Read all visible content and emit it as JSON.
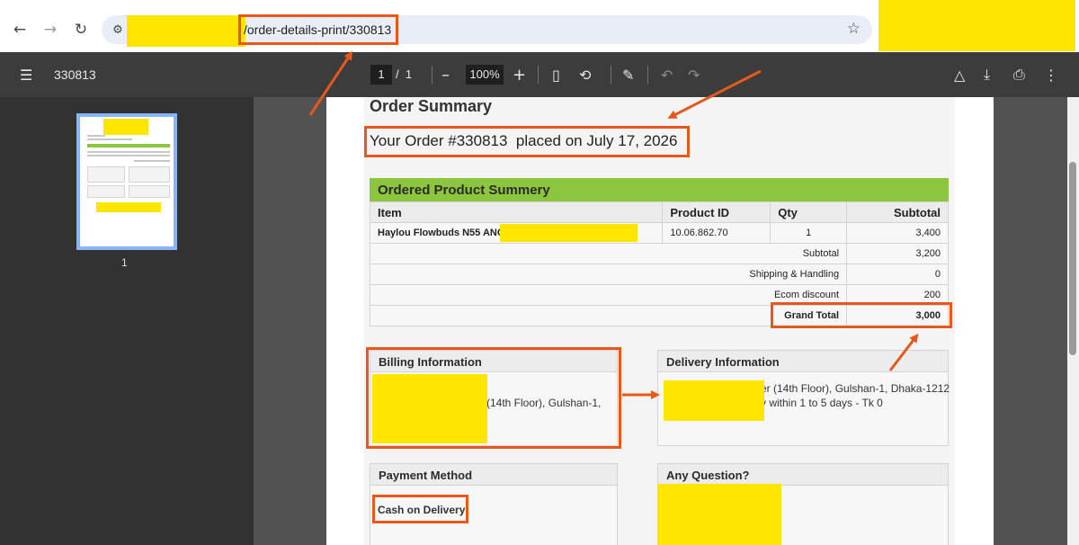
{
  "browser": {
    "back_icon": "back-arrow-icon",
    "forward_icon": "forward-arrow-icon",
    "reload_icon": "reload-icon",
    "url_visible": "/order-details-print/330813",
    "bookmark_icon": "star-icon"
  },
  "pdf_toolbar": {
    "title": "330813",
    "current_page": "1",
    "page_separator": "/",
    "total_pages": "1",
    "zoom_out": "–",
    "zoom": "100%",
    "zoom_in": "+"
  },
  "sidebar": {
    "thumbnail_page_label": "1"
  },
  "document": {
    "heading": "Order Summary",
    "order_line": "Your Order #330813  placed on July 17, 2026",
    "products_section_title": "Ordered Product Summery",
    "table_headers": [
      "Item",
      "Product ID",
      "Qty",
      "Subtotal"
    ],
    "rows": [
      {
        "item": "Haylou Flowbuds N55 ANC",
        "product_id": "10.06.862.70",
        "qty": "1",
        "subtotal": "3,400"
      }
    ],
    "summary": {
      "subtotal_label": "Subtotal",
      "subtotal_value": "3,200",
      "shipping_label": "Shipping & Handling",
      "shipping_value": "0",
      "discount_label": "Ecom discount",
      "discount_value": "200",
      "grand_total_label": "Grand Total",
      "grand_total_value": "3,000"
    },
    "billing": {
      "title": "Billing Information",
      "text": "(14th Floor), Gulshan-1,"
    },
    "delivery": {
      "title": "Delivery Information",
      "line1": "er (14th Floor), Gulshan-1, Dhaka-1212",
      "line2": "y within 1 to 5 days - Tk 0"
    },
    "payment": {
      "title": "Payment Method",
      "value": "Cash on Delivery"
    },
    "question": {
      "title": "Any Question?"
    }
  },
  "colors": {
    "highlight": "#e8571c",
    "redaction": "#ffe600",
    "green_bar": "#8cc63f"
  }
}
